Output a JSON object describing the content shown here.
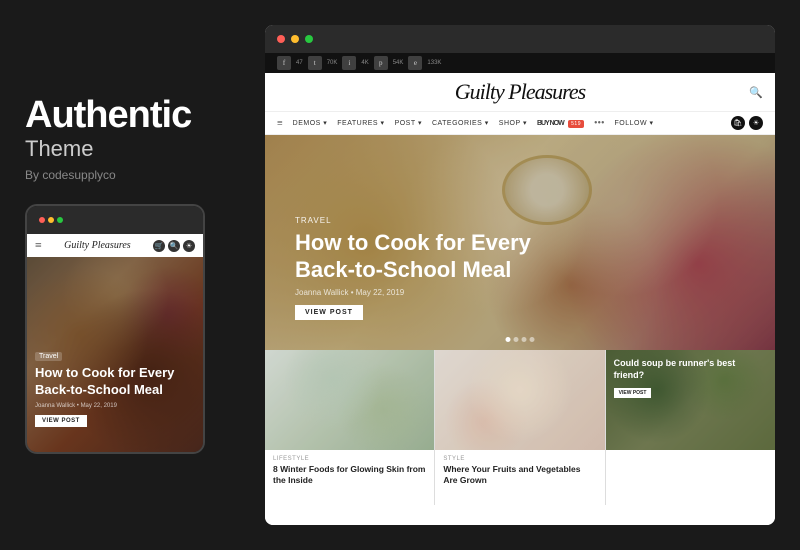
{
  "theme": {
    "name": "Authentic",
    "type": "Theme",
    "author": "By codesupplyco",
    "bg_color": "#1a1a1a"
  },
  "desktop_mockup": {
    "dots": [
      "#ff5f57",
      "#ffbd2e",
      "#28c840"
    ],
    "social_bar": {
      "icons": [
        "f",
        "t",
        "i",
        "p",
        "e"
      ],
      "counts": [
        "47",
        "70K",
        "4K",
        "54K",
        "133K"
      ]
    },
    "logo": "Guilty Pleasures",
    "nav_items": [
      "DEMOS",
      "FEATURES",
      "POST",
      "CATEGORIES",
      "SHOP",
      "BUY NOW",
      "•••",
      "FOLLOW",
      ""
    ],
    "buy_now_badge": "519",
    "hero": {
      "tag": "Travel",
      "title": "How to Cook for Every Back-to-School Meal",
      "meta": "Joanna Wallick  •  May 22, 2019",
      "btn_label": "VIEW POST"
    },
    "grid_cards": [
      {
        "tag": "Lifestyle",
        "title": "8 Winter Foods for Glowing Skin from the Inside"
      },
      {
        "tag": "Style",
        "title": "Where Your Fruits and Vegetables Are Grown"
      },
      {
        "tag": "",
        "title": "Could soup be runner's best friend?",
        "has_overlay": true,
        "btn_label": "VIEW POST"
      }
    ]
  },
  "mobile_mockup": {
    "dots": [
      "#ff5f57",
      "#ffbd2e",
      "#28c840"
    ],
    "logo": "Guilty Pleasures",
    "hero": {
      "tag": "Travel",
      "title": "How to Cook for Every Back-to-School Meal",
      "author": "Joanna Wallick  •  May 22, 2019",
      "btn_label": "VIEW POST"
    }
  }
}
